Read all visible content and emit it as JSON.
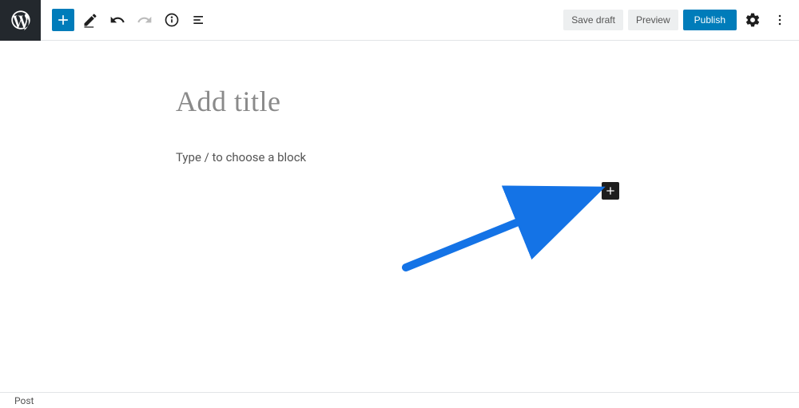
{
  "toolbar": {
    "save_draft_label": "Save draft",
    "preview_label": "Preview",
    "publish_label": "Publish"
  },
  "editor": {
    "title_placeholder": "Add title",
    "block_placeholder": "Type / to choose a block"
  },
  "footer": {
    "breadcrumb": "Post"
  },
  "icons": {
    "wp_logo": "wordpress-logo",
    "add_block": "plus-icon",
    "tools": "pencil-icon",
    "undo": "undo-icon",
    "redo": "redo-icon",
    "info": "info-icon",
    "outline": "outline-icon",
    "settings": "gear-icon",
    "more": "more-vertical-icon",
    "inline_inserter": "plus-icon"
  },
  "annotation": {
    "arrow_color": "#1473e6"
  }
}
